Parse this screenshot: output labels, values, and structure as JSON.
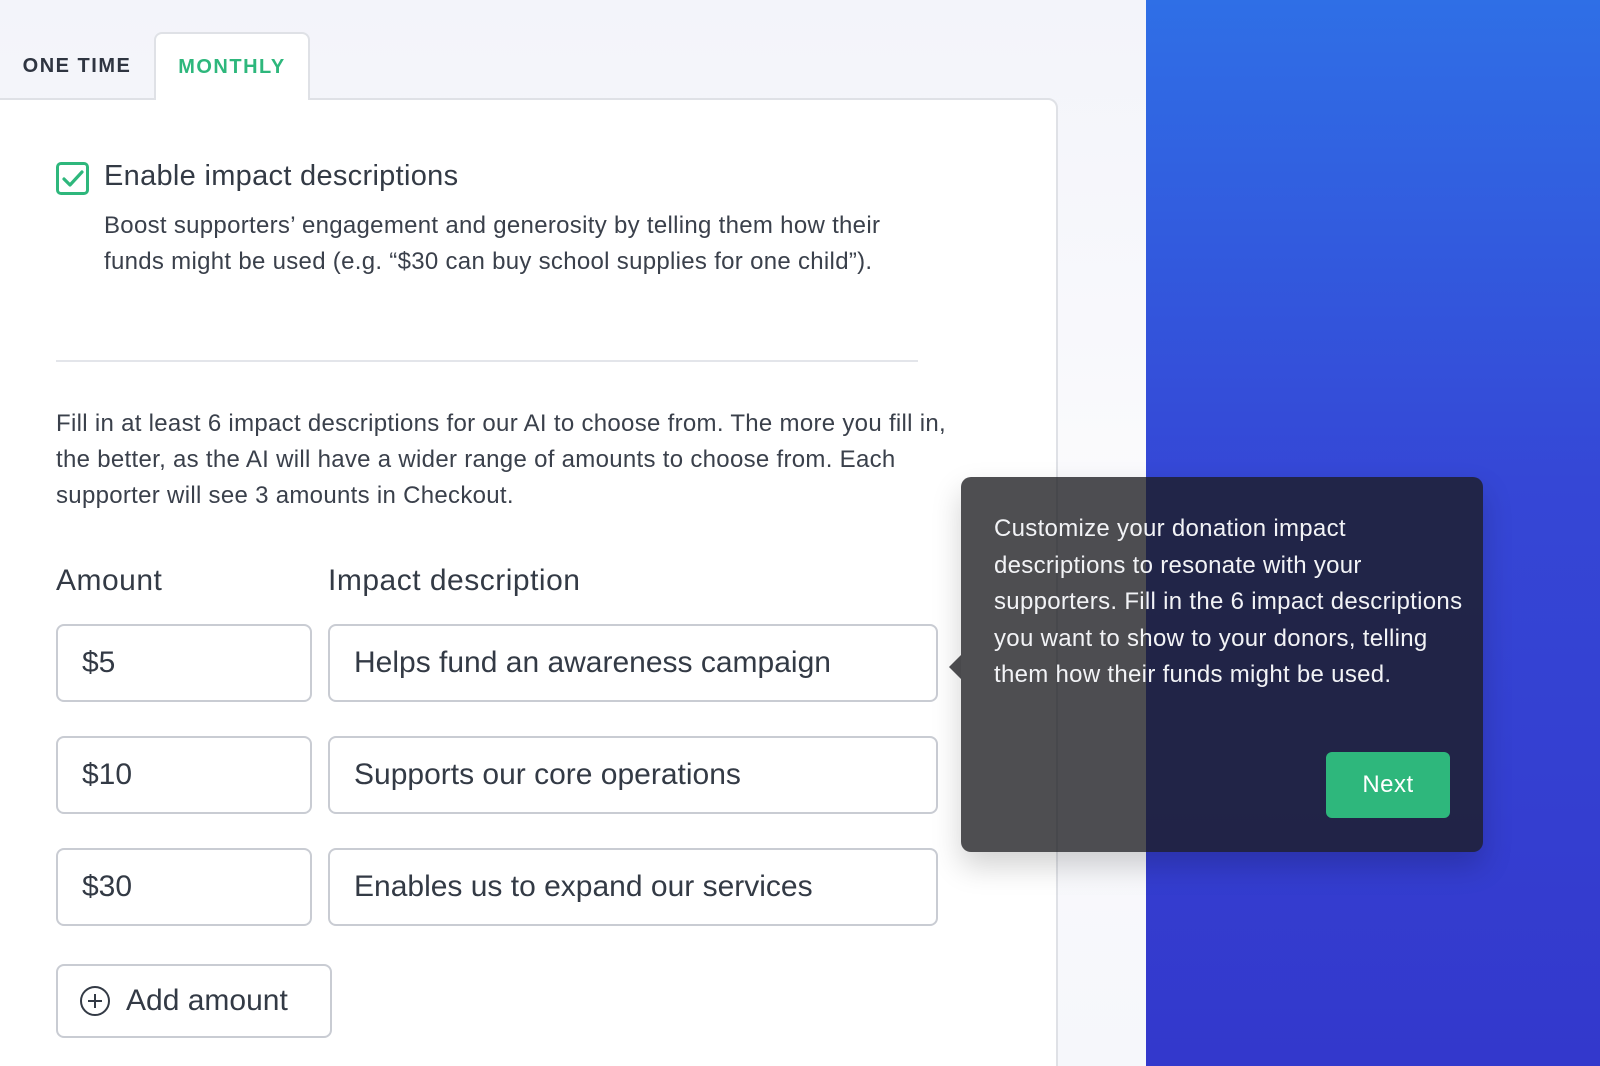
{
  "tabs": [
    {
      "label": "ONE TIME",
      "active": false
    },
    {
      "label": "MONTHLY",
      "active": true
    }
  ],
  "impact": {
    "checkbox_label": "Enable impact descriptions",
    "checked": true,
    "helper_text": "Boost supporters’ engagement and generosity by telling them how their funds might be used (e.g. “$30 can buy school supplies for one child”).",
    "instructions": "Fill in at least 6 impact descriptions for our AI to choose from. The more you fill in, the better, as the AI will have a wider range of amounts to choose from. Each supporter will see 3 amounts in Checkout.",
    "columns": {
      "amount": "Amount",
      "description": "Impact description"
    },
    "rows": [
      {
        "amount": "$5",
        "description": "Helps fund an awareness campaign"
      },
      {
        "amount": "$10",
        "description": "Supports our core operations"
      },
      {
        "amount": "$30",
        "description": "Enables us to expand our services"
      }
    ],
    "add_amount_label": "Add amount"
  },
  "tooltip": {
    "text": "Customize your donation impact descriptions to resonate with your supporters. Fill in the 6 impact descriptions you want to show to your donors, telling them how their funds might be used.",
    "next_label": "Next"
  },
  "colors": {
    "accent_green": "#2eb77c",
    "panel_blue": "#3547d6",
    "tooltip_bg": "#1c1c20"
  }
}
